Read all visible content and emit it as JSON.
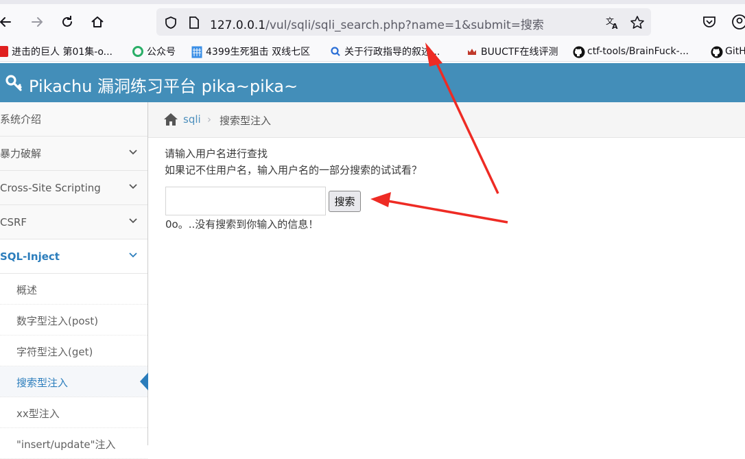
{
  "browser": {
    "url_host": "127.0.0.1",
    "url_path": "/vul/sqli/sqli_search.php?name=1&submit=搜索",
    "icons": [
      "back-icon",
      "forward-icon",
      "reload-icon",
      "home-icon",
      "shield-icon",
      "page-icon",
      "translate-icon",
      "star-icon",
      "pocket-icon",
      "account-icon"
    ]
  },
  "bookmarks": [
    {
      "label": "进击的巨人 第01集-o...",
      "icon": "video-icon",
      "color": "#e02020"
    },
    {
      "label": "公众号",
      "icon": "wechat-icon",
      "color": "#2aae67"
    },
    {
      "label": "4399生死狙击 双线七区",
      "icon": "grid-icon",
      "color": "#3a8ee6"
    },
    {
      "label": "关于行政指导的叙述...",
      "icon": "search-icon",
      "color": "#2b6fd6"
    },
    {
      "label": "BUUCTF在线评测",
      "icon": "buu-icon",
      "color": "#c0392b"
    },
    {
      "label": "ctf-tools/BrainFuck-...",
      "icon": "github-icon",
      "color": "#111111"
    },
    {
      "label": "GitH",
      "icon": "github-icon",
      "color": "#111111"
    }
  ],
  "header": {
    "title": "Pikachu 漏洞练习平台 pika~pika~",
    "bg_color": "#438eb9"
  },
  "sidebar": {
    "items": [
      {
        "label": "系统介绍",
        "has_chevron": false
      },
      {
        "label": "暴力破解",
        "has_chevron": true
      },
      {
        "label": "Cross-Site Scripting",
        "has_chevron": true
      },
      {
        "label": "CSRF",
        "has_chevron": true
      },
      {
        "label": "SQL-Inject",
        "has_chevron": true,
        "open": true
      }
    ],
    "sub_items": [
      {
        "label": "概述"
      },
      {
        "label": "数字型注入(post)"
      },
      {
        "label": "字符型注入(get)"
      },
      {
        "label": "搜索型注入",
        "active": true
      },
      {
        "label": "xx型注入"
      },
      {
        "label": "\"insert/update\"注入"
      }
    ]
  },
  "breadcrumb": {
    "link": "sqli",
    "current": "搜索型注入"
  },
  "main": {
    "line1": "请输入用户名进行查找",
    "line2": "如果记不住用户名，输入用户名的一部分搜索的试试看？",
    "search_value": "",
    "search_button": "搜索",
    "result": "0o。..没有搜索到你输入的信息！"
  },
  "annotation_color": "#ee2b24"
}
